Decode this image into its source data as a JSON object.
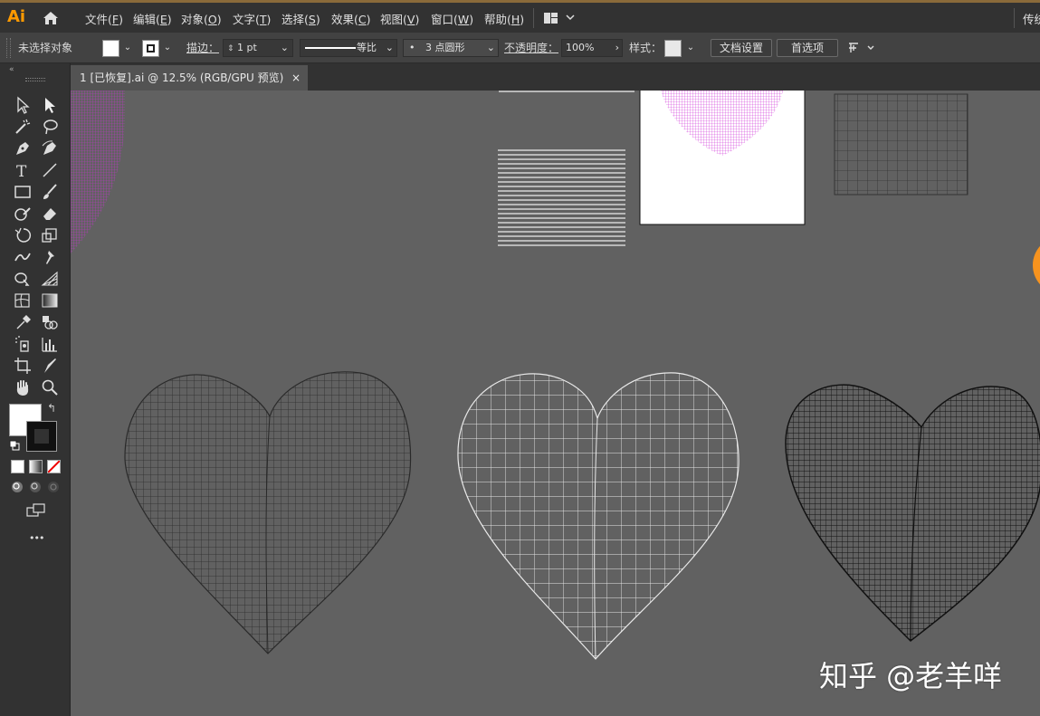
{
  "app": {
    "logo": "Ai",
    "right_label": "传统"
  },
  "menu": [
    {
      "label": "文件(",
      "key": "F",
      "tail": ")"
    },
    {
      "label": "编辑(",
      "key": "E",
      "tail": ")"
    },
    {
      "label": "对象(",
      "key": "O",
      "tail": ")"
    },
    {
      "label": "文字(",
      "key": "T",
      "tail": ")"
    },
    {
      "label": "选择(",
      "key": "S",
      "tail": ")"
    },
    {
      "label": "效果(",
      "key": "C",
      "tail": ")"
    },
    {
      "label": "视图(",
      "key": "V",
      "tail": ")"
    },
    {
      "label": "窗口(",
      "key": "W",
      "tail": ")"
    },
    {
      "label": "帮助(",
      "key": "H",
      "tail": ")"
    }
  ],
  "control": {
    "selection_status": "未选择对象",
    "stroke_label": "描边：",
    "stroke_weight": "1 pt",
    "profile": "等比",
    "brush": "3 点圆形",
    "brush_dot": "•",
    "opacity_label": "不透明度：",
    "opacity": "100%",
    "style_label": "样式：",
    "doc_setup": "文档设置",
    "preferences": "首选项"
  },
  "tab": {
    "title": "1 [已恢复].ai @ 12.5% (RGB/GPU 预览)",
    "close": "×"
  },
  "toolbar": {
    "more": "•••"
  },
  "watermark": "知乎 @老羊咩",
  "colors": {
    "accent": "#ff9a00",
    "magenta": "#e040e0",
    "canvas": "#616161",
    "orange": "#f7931e"
  }
}
